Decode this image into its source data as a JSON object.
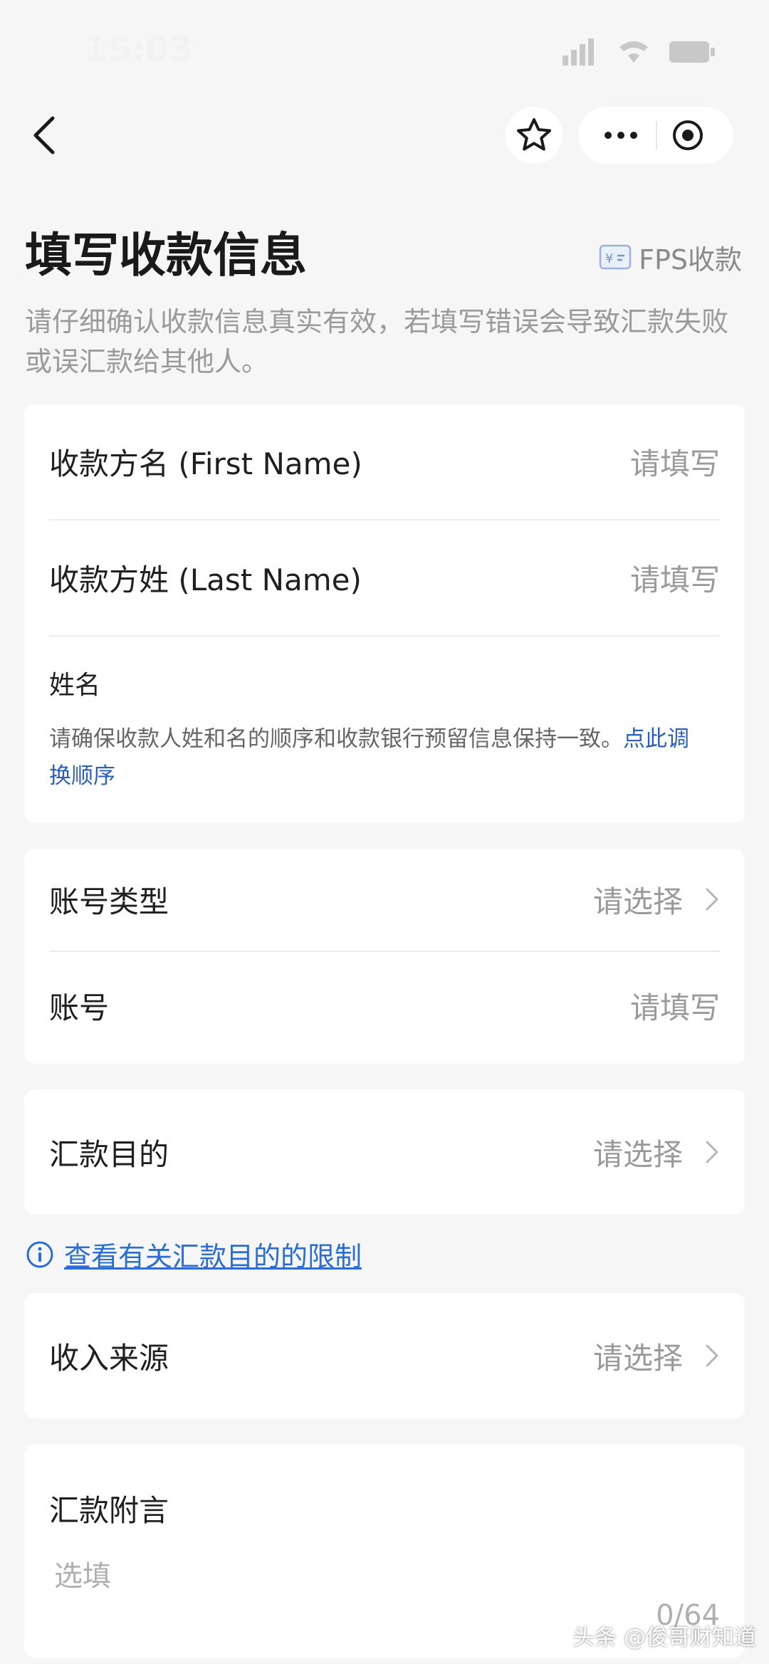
{
  "status_bar": {
    "time": "15:03"
  },
  "header": {
    "title": "填写收款信息",
    "tag": "FPS收款",
    "intro": "请仔细确认收款信息真实有效，若填写错误会导致汇款失败或误汇款给其他人。"
  },
  "name_card": {
    "first_name_label": "收款方名 (First Name)",
    "first_name_placeholder": "请填写",
    "last_name_label": "收款方姓 (Last Name)",
    "last_name_placeholder": "请填写",
    "full_name_label": "姓名",
    "hint_text": "请确保收款人姓和名的顺序和收款银行预留信息保持一致。",
    "swap_link": "点此调换顺序"
  },
  "account_card": {
    "type_label": "账号类型",
    "type_value": "请选择",
    "number_label": "账号",
    "number_placeholder": "请填写"
  },
  "purpose_card": {
    "label": "汇款目的",
    "value": "请选择"
  },
  "purpose_limit_link": "查看有关汇款目的的限制",
  "income_card": {
    "label": "收入来源",
    "value": "请选择"
  },
  "remark_card": {
    "label": "汇款附言",
    "placeholder": "选填",
    "counter": "0/64"
  },
  "watermark": "头条 @俊哥财知道",
  "colors": {
    "link": "#2a6dd6",
    "placeholder": "#9a9a9a",
    "background": "#f6f6f6"
  }
}
